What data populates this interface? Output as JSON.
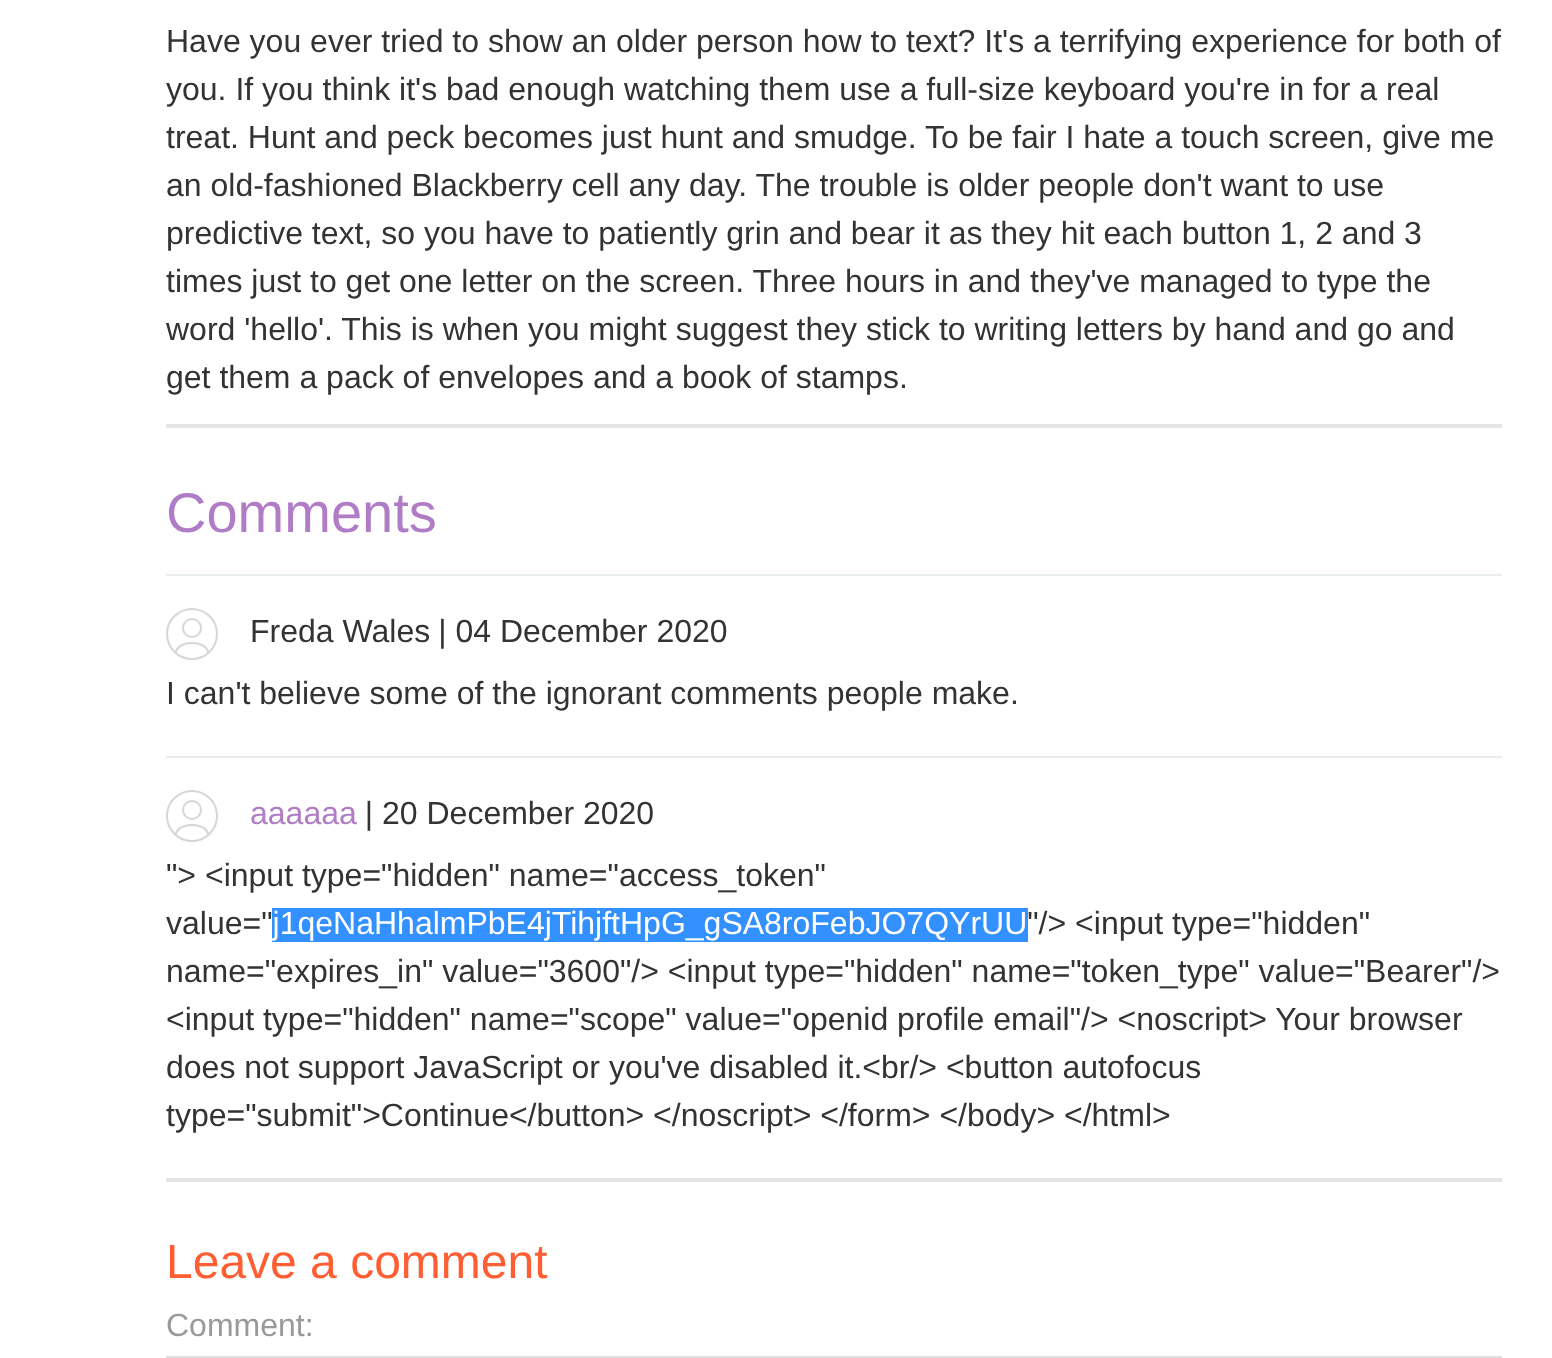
{
  "article": {
    "body": "Have you ever tried to show an older person how to text? It's a terrifying experience for both of you. If you think it's bad enough watching them use a full-size keyboard you're in for a real treat. Hunt and peck becomes just hunt and smudge. To be fair I hate a touch screen, give me an old-fashioned Blackberry cell any day. The trouble is older people don't want to use predictive text, so you have to patiently grin and bear it as they hit each button 1, 2 and 3 times just to get one letter on the screen. Three hours in and they've managed to type the word 'hello'. This is when you might suggest they stick to writing letters by hand and go and get them a pack of envelopes and a book of stamps."
  },
  "comments": {
    "title": "Comments",
    "items": [
      {
        "author": "Freda Wales",
        "link": false,
        "date": "| 04 December 2020",
        "body": [
          {
            "text": "I can't believe some of the ignorant comments people make.",
            "selected": false
          }
        ]
      },
      {
        "author": "aaaaaa",
        "link": true,
        "date": "| 20 December 2020",
        "body": [
          {
            "text": "\"> <input type=\"hidden\" name=\"access_token\" value=\"",
            "selected": false
          },
          {
            "text": "j1qeNaHhalmPbE4jTihjftHpG_gSA8roFebJO7QYrUU",
            "selected": true
          },
          {
            "text": "\"/> <input type=\"hidden\" name=\"expires_in\" value=\"3600\"/> <input type=\"hidden\" name=\"token_type\" value=\"Bearer\"/> <input type=\"hidden\" name=\"scope\" value=\"openid profile email\"/> <noscript> Your browser does not support JavaScript or you've disabled it.<br/> <button autofocus type=\"submit\">Continue</button> </noscript> </form> </body> </html>",
            "selected": false
          }
        ]
      }
    ]
  },
  "leave_comment": {
    "title": "Leave a comment",
    "comment_label": "Comment:"
  }
}
